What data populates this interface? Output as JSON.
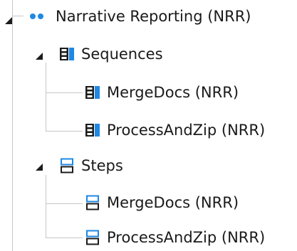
{
  "tree": {
    "root": {
      "label": "Narrative Reporting (NRR)",
      "expanded": true,
      "icon": "dots-icon",
      "children": {
        "sequences": {
          "label": "Sequences",
          "expanded": true,
          "icon": "sequence-icon",
          "items": [
            {
              "label": "MergeDocs (NRR)",
              "icon": "sequence-icon"
            },
            {
              "label": "ProcessAndZip (NRR)",
              "icon": "sequence-icon"
            }
          ]
        },
        "steps": {
          "label": "Steps",
          "expanded": true,
          "icon": "step-icon",
          "items": [
            {
              "label": "MergeDocs (NRR)",
              "icon": "step-icon"
            },
            {
              "label": "ProcessAndZip (NRR)",
              "icon": "step-icon"
            }
          ]
        }
      }
    }
  },
  "colors": {
    "accent_blue": "#1e88e5",
    "icon_dark": "#1c1c1c",
    "connector_line": "#c6c6c6",
    "text": "#1a1a1a"
  }
}
